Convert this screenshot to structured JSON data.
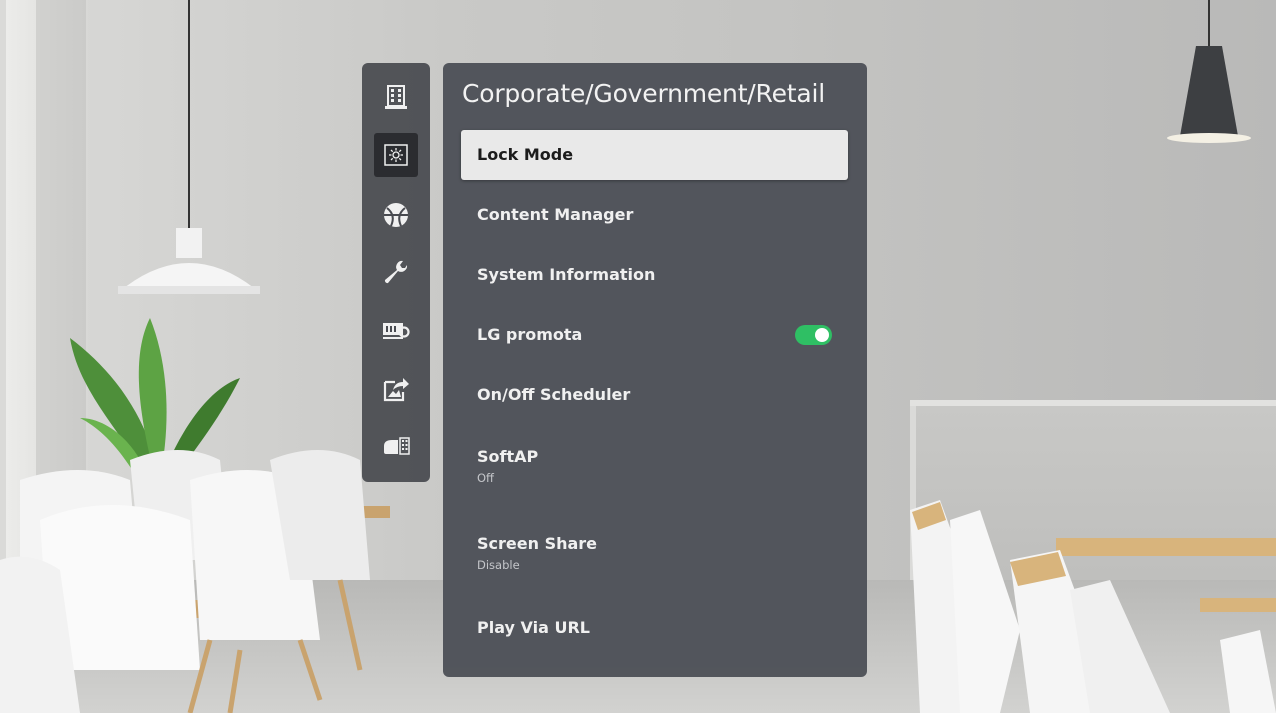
{
  "menu": {
    "title": "Corporate/Government/Retail",
    "items": [
      {
        "label": "Lock Mode",
        "selected": true
      },
      {
        "label": "Content Manager"
      },
      {
        "label": "System Information"
      },
      {
        "label": "LG promota",
        "toggle": "on"
      },
      {
        "label": "On/Off Scheduler"
      },
      {
        "label": "SoftAP",
        "value": "Off"
      },
      {
        "label": "Screen Share",
        "value": "Disable"
      },
      {
        "label": "Play Via URL"
      }
    ]
  },
  "side_rail": {
    "icons": [
      {
        "name": "building-icon"
      },
      {
        "name": "screen-settings-icon",
        "active": true
      },
      {
        "name": "network-globe-icon"
      },
      {
        "name": "wrench-icon"
      },
      {
        "name": "device-settings-icon"
      },
      {
        "name": "share-icon"
      },
      {
        "name": "accessibility-icon"
      }
    ]
  },
  "colors": {
    "panel": "#4c4f56",
    "selected_item": "#e9e9e9",
    "toggle_on": "#2fbf64"
  }
}
